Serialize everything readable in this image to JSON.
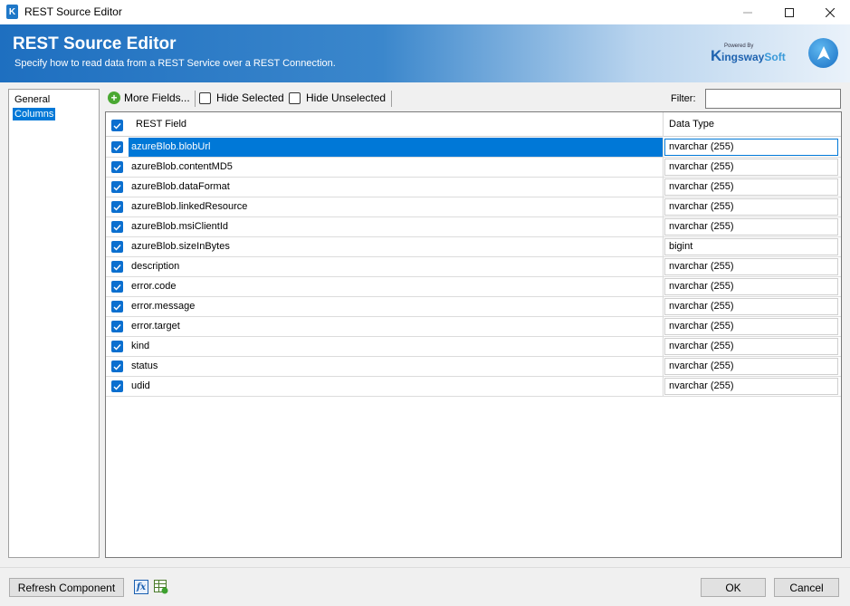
{
  "window": {
    "title": "REST Source Editor",
    "app_icon_letter": "K"
  },
  "banner": {
    "title": "REST Source Editor",
    "subtitle": "Specify how to read data from a REST Service over a REST Connection.",
    "logo_powered": "Powered By",
    "logo_k": "K",
    "logo_name_main": "ingsway",
    "logo_name_soft": "Soft"
  },
  "nav": {
    "items": [
      {
        "label": "General",
        "selected": false
      },
      {
        "label": "Columns",
        "selected": true
      }
    ]
  },
  "toolbar": {
    "more_fields": "More Fields...",
    "hide_selected": "Hide Selected",
    "hide_unselected": "Hide Unselected",
    "filter_label": "Filter:",
    "filter_value": ""
  },
  "grid": {
    "columns": [
      "REST Field",
      "Data Type"
    ],
    "header_checked": true,
    "rows": [
      {
        "field": "azureBlob.blobUrl",
        "type": "nvarchar (255)",
        "checked": true,
        "selected": true
      },
      {
        "field": "azureBlob.contentMD5",
        "type": "nvarchar (255)",
        "checked": true,
        "selected": false
      },
      {
        "field": "azureBlob.dataFormat",
        "type": "nvarchar (255)",
        "checked": true,
        "selected": false
      },
      {
        "field": "azureBlob.linkedResource",
        "type": "nvarchar (255)",
        "checked": true,
        "selected": false
      },
      {
        "field": "azureBlob.msiClientId",
        "type": "nvarchar (255)",
        "checked": true,
        "selected": false
      },
      {
        "field": "azureBlob.sizeInBytes",
        "type": "bigint",
        "checked": true,
        "selected": false
      },
      {
        "field": "description",
        "type": "nvarchar (255)",
        "checked": true,
        "selected": false
      },
      {
        "field": "error.code",
        "type": "nvarchar (255)",
        "checked": true,
        "selected": false
      },
      {
        "field": "error.message",
        "type": "nvarchar (255)",
        "checked": true,
        "selected": false
      },
      {
        "field": "error.target",
        "type": "nvarchar (255)",
        "checked": true,
        "selected": false
      },
      {
        "field": "kind",
        "type": "nvarchar (255)",
        "checked": true,
        "selected": false
      },
      {
        "field": "status",
        "type": "nvarchar (255)",
        "checked": true,
        "selected": false
      },
      {
        "field": "udid",
        "type": "nvarchar (255)",
        "checked": true,
        "selected": false
      }
    ]
  },
  "footer": {
    "refresh_label": "Refresh Component",
    "fx_label": "fx",
    "ok_label": "OK",
    "cancel_label": "Cancel"
  },
  "colors": {
    "accent": "#0078d7",
    "banner_start": "#1e6fc0",
    "checkbox": "#0b6fcf",
    "plus_green": "#4aa832"
  }
}
